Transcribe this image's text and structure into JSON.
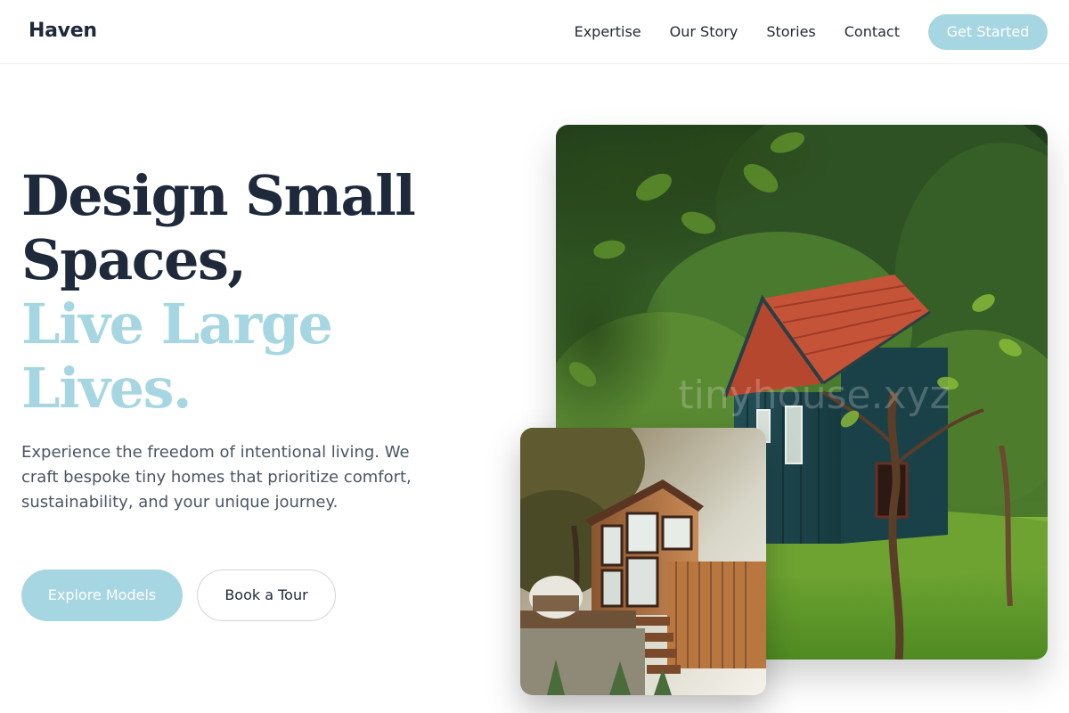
{
  "header": {
    "logo": "Haven",
    "nav": [
      {
        "label": "Expertise"
      },
      {
        "label": "Our Story"
      },
      {
        "label": "Stories"
      },
      {
        "label": "Contact"
      }
    ],
    "cta_label": "Get Started"
  },
  "hero": {
    "headline_line1": "Design Small",
    "headline_line2": "Spaces,",
    "headline_accent_line1": "Live Large",
    "headline_accent_line2": "Lives.",
    "description": "Experience the freedom of intentional living. We craft bespoke tiny homes that prioritize comfort, sustainability, and your unique journey.",
    "primary_button": "Explore Models",
    "secondary_button": "Book a Tour"
  },
  "images": {
    "main_watermark": "tinyhouse.xyz",
    "main": "green cabin with red tile roof in forest",
    "secondary": "modern wooden tiny house on stilts"
  },
  "colors": {
    "accent": "#a7d6e3",
    "heading": "#1e293b",
    "body_text": "#4b5563"
  }
}
